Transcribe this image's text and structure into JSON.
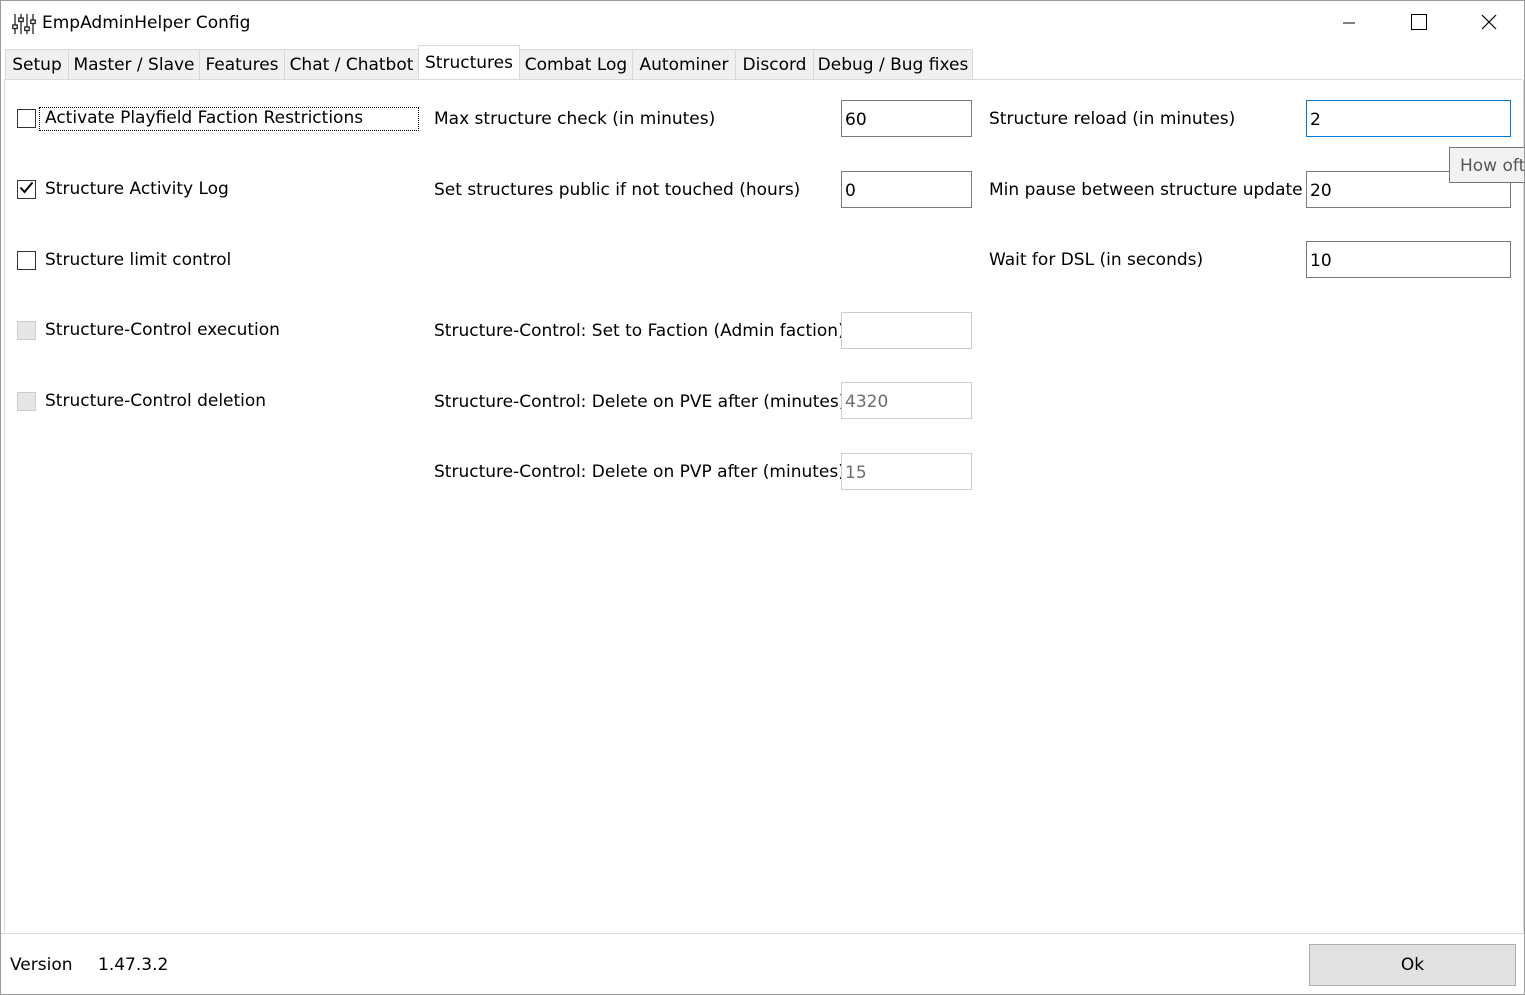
{
  "window": {
    "title": "EmpAdminHelper Config"
  },
  "tabs": [
    {
      "label": "Setup"
    },
    {
      "label": "Master / Slave"
    },
    {
      "label": "Features"
    },
    {
      "label": "Chat / Chatbot"
    },
    {
      "label": "Structures",
      "active": true
    },
    {
      "label": "Combat Log"
    },
    {
      "label": "Autominer"
    },
    {
      "label": "Discord"
    },
    {
      "label": "Debug / Bug fixes"
    }
  ],
  "checkboxes": [
    {
      "label": "Activate Playfield Faction Restrictions",
      "checked": false,
      "enabled": true
    },
    {
      "label": "Structure Activity Log",
      "checked": true,
      "enabled": true
    },
    {
      "label": "Structure limit control",
      "checked": false,
      "enabled": true
    },
    {
      "label": "Structure-Control execution",
      "checked": false,
      "enabled": false
    },
    {
      "label": "Structure-Control deletion",
      "checked": false,
      "enabled": false
    }
  ],
  "middle_fields": [
    {
      "label": "Max structure check (in minutes)",
      "value": "60",
      "enabled": true
    },
    {
      "label": "Set structures public if not touched (hours)",
      "value": "0",
      "enabled": true
    },
    {
      "label": "Structure-Control: Set to Faction (Admin faction)",
      "value": "",
      "enabled": false
    },
    {
      "label": "Structure-Control: Delete on PVE after (minutes)",
      "value": "4320",
      "enabled": false
    },
    {
      "label": "Structure-Control: Delete on PVP after (minutes)",
      "value": "15",
      "enabled": false
    }
  ],
  "right_fields": [
    {
      "label": "Structure reload (in minutes)",
      "value": "2",
      "focused": true
    },
    {
      "label": "Min pause between structure update",
      "value": "20"
    },
    {
      "label": "Wait for DSL (in seconds)",
      "value": "10"
    }
  ],
  "tooltip": {
    "text": "How ofte"
  },
  "footer": {
    "version_label": "Version",
    "version_value": "1.47.3.2",
    "ok_label": "Ok"
  },
  "icons": {
    "app": "sliders-icon",
    "minimize": "minimize-icon",
    "maximize": "maximize-icon",
    "close": "close-icon",
    "check": "checkmark-icon"
  }
}
